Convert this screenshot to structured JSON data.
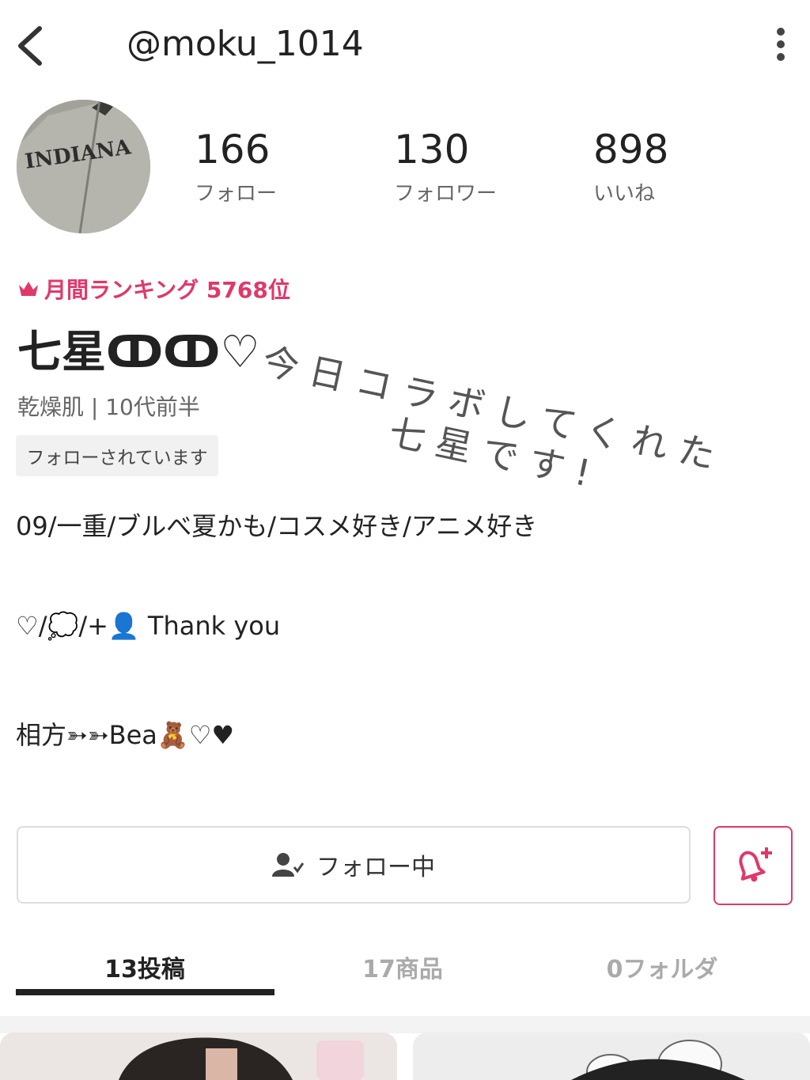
{
  "header": {
    "username": "@moku_1014",
    "back_icon": "chevron-left-icon",
    "more_icon": "more-vertical-icon"
  },
  "profile": {
    "avatar_text": "INDIANA",
    "stats": [
      {
        "value": "166",
        "label": "フォロー"
      },
      {
        "value": "130",
        "label": "フォロワー"
      },
      {
        "value": "898",
        "label": "いいね"
      }
    ],
    "ranking": "月間ランキング 5768位",
    "name": "七星ↀↀ♡",
    "skin": "乾燥肌 | 10代前半",
    "follow_status": "フォローされています",
    "bio_lines": [
      "09/一重/ブルべ夏かも/コスメ好き/アニメ好き",
      "♡/💭/+👤 Thank you",
      "相方➳➳Bea🧸♡♥"
    ]
  },
  "overlay": {
    "line1": "今日コラボしてくれた",
    "line2": "七星です!"
  },
  "actions": {
    "follow_label": "フォロー中"
  },
  "tabs": [
    {
      "label": "13投稿",
      "active": true
    },
    {
      "label": "17商品",
      "active": false
    },
    {
      "label": "0フォルダ",
      "active": false
    }
  ],
  "colors": {
    "accent": "#e0386b",
    "text": "#222222",
    "muted": "#666666"
  }
}
